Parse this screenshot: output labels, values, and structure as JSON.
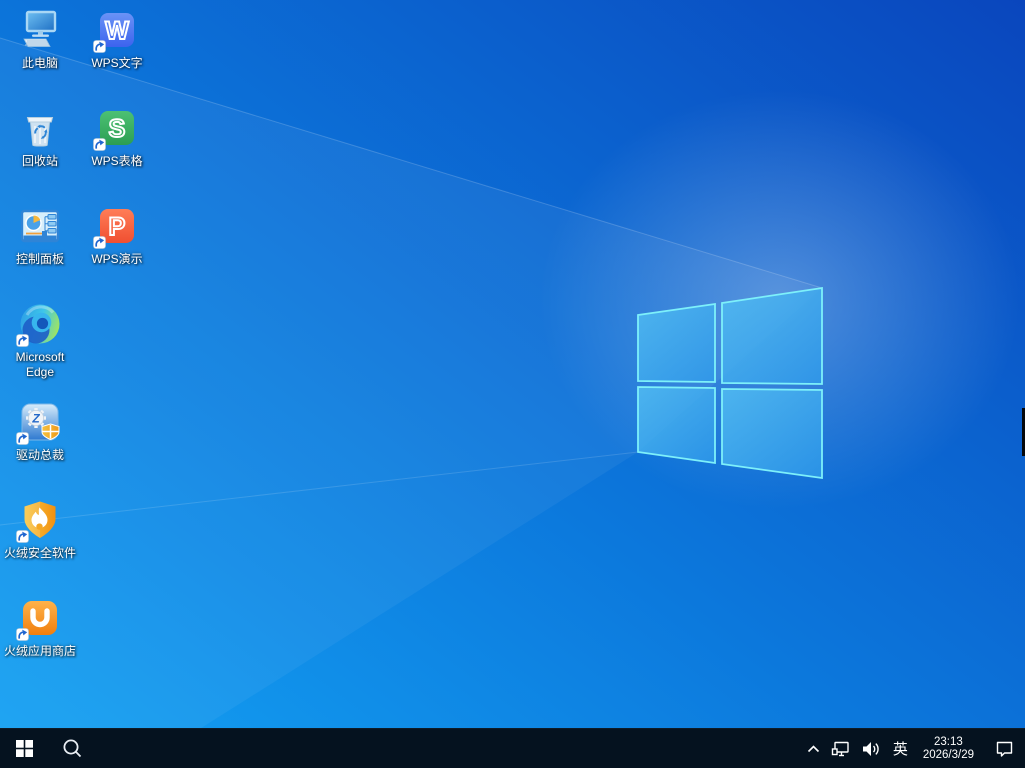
{
  "desktop": {
    "icons": [
      {
        "name": "this-pc",
        "label": "此电脑"
      },
      {
        "name": "recycle-bin",
        "label": "回收站"
      },
      {
        "name": "control-panel",
        "label": "控制面板"
      },
      {
        "name": "microsoft-edge",
        "label": "Microsoft Edge"
      },
      {
        "name": "driver-genius",
        "label": "驱动总裁"
      },
      {
        "name": "huorong-security",
        "label": "火绒安全软件"
      },
      {
        "name": "huorong-app-store",
        "label": "火绒应用商店"
      },
      {
        "name": "wps-writer",
        "label": "WPS文字"
      },
      {
        "name": "wps-spreadsheet",
        "label": "WPS表格"
      },
      {
        "name": "wps-presentation",
        "label": "WPS演示"
      }
    ],
    "wps_letters": {
      "writer": "W",
      "spreadsheet": "S",
      "presentation": "P"
    }
  },
  "taskbar": {
    "language_indicator": "英",
    "clock": {
      "time": "23:13",
      "date": "2026/3/29"
    }
  },
  "colors": {
    "wallpaper_bottom_left": "#14a3f4",
    "wallpaper_top_right": "#0a46bd",
    "logo_pane_fill": "#43b0ef",
    "logo_pane_edge": "#7df0fa",
    "taskbar_bg": "#05121f",
    "label_text": "#ffffff"
  }
}
